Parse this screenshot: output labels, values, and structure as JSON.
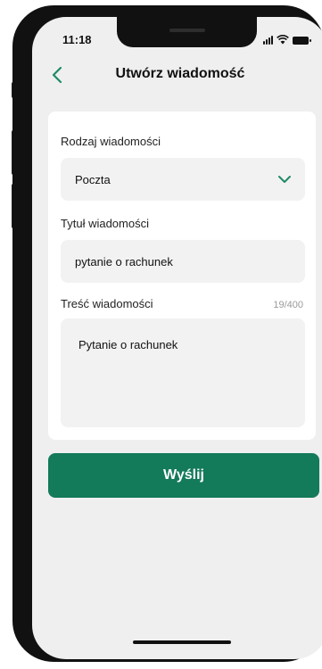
{
  "status_bar": {
    "time": "11:18"
  },
  "header": {
    "title": "Utwórz wiadomość"
  },
  "form": {
    "type_label": "Rodzaj wiadomości",
    "type_value": "Poczta",
    "title_label": "Tytuł wiadomości",
    "title_value": "pytanie o rachunek",
    "content_label": "Treść wiadomości",
    "content_counter": "19/400",
    "content_value": "Pytanie o rachunek"
  },
  "actions": {
    "send_label": "Wyślij"
  },
  "colors": {
    "accent": "#137a5a",
    "chevron": "#1f8a68",
    "background": "#efefef"
  }
}
